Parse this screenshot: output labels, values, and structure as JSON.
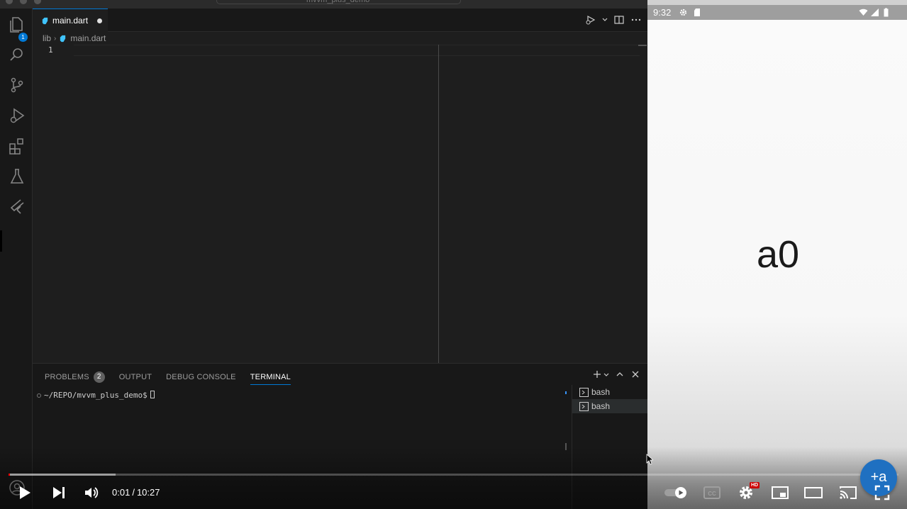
{
  "window": {
    "title": "mvvm_plus_demo"
  },
  "activity_bar": {
    "explorer_badge": "1",
    "items": [
      "explorer-icon",
      "search-icon",
      "source-control-icon",
      "run-debug-icon",
      "extensions-icon",
      "testing-icon",
      "flutter-icon"
    ]
  },
  "editor": {
    "tab_label": "main.dart",
    "breadcrumb": {
      "folder": "lib",
      "file": "main.dart"
    },
    "line_numbers": [
      "1"
    ]
  },
  "panel": {
    "tabs": [
      {
        "label": "PROBLEMS",
        "count": "2"
      },
      {
        "label": "OUTPUT"
      },
      {
        "label": "DEBUG CONSOLE"
      },
      {
        "label": "TERMINAL",
        "active": true
      }
    ],
    "terminal_prompt": "~/REPO/mvvm_plus_demo$",
    "terminals": [
      "bash",
      "bash"
    ]
  },
  "phone": {
    "status_time": "9:32",
    "counter_text": "a0",
    "fab_label": "+a"
  },
  "player": {
    "current_time": "0:01",
    "duration": "10:27",
    "played_fraction": 0.0016,
    "loaded_fraction": 0.12,
    "hd_badge": "HD",
    "accent_color": "#ff0000"
  },
  "colors": {
    "editor_bg": "#1e1e1e",
    "accent_blue": "#0078d4",
    "fab_blue": "#1f70c1"
  }
}
